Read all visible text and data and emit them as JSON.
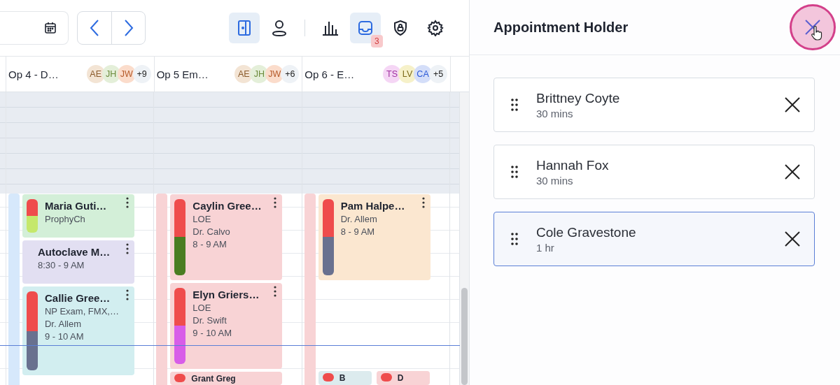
{
  "toolbar": {
    "date_field": {
      "kind": "date"
    },
    "tools": [
      {
        "kind": "door",
        "selected": true
      },
      {
        "kind": "person",
        "selected": false
      },
      {
        "kind": "chart",
        "selected": false
      },
      {
        "kind": "inbox",
        "selected": true,
        "badge": "3"
      },
      {
        "kind": "shield",
        "selected": false
      },
      {
        "kind": "gear",
        "selected": false
      }
    ]
  },
  "columns": [
    {
      "title": "Op 4 - D…",
      "color": "#d6e8fb",
      "avatars": [
        {
          "initials": "AE",
          "color": "#f3e4d4"
        },
        {
          "initials": "JH",
          "color": "#e4efd9"
        },
        {
          "initials": "JW",
          "color": "#fbdccb"
        },
        {
          "initials": "+9",
          "color": "#eef2f6"
        }
      ],
      "cards": [
        {
          "kind": "appointment",
          "name": "Maria Guti…",
          "lines": [
            "ProphyCh"
          ],
          "color": "#d3efd8",
          "bar": [
            {
              "color": "#ef4c4c"
            },
            {
              "color": "#c5e86b"
            }
          ]
        },
        {
          "kind": "block",
          "name": "Autoclave M…",
          "lines": [
            "8:30 - 9 AM"
          ],
          "color": "#e2dff2"
        },
        {
          "kind": "appointment",
          "name": "Callie Gree…",
          "lines": [
            "NP Exam, FMX,…",
            "Dr. Allem",
            "9 - 10 AM"
          ],
          "color": "#d2eef0",
          "bar": [
            {
              "color": "#ef4c4c"
            },
            {
              "color": "#69718f"
            }
          ]
        }
      ]
    },
    {
      "title": "Op 5 Em…",
      "color": "#f8d3d5",
      "avatars": [
        {
          "initials": "AE",
          "color": "#f3e4d4"
        },
        {
          "initials": "JH",
          "color": "#e4efd9"
        },
        {
          "initials": "JW",
          "color": "#fbdccb"
        },
        {
          "initials": "+6",
          "color": "#eef2f6"
        }
      ],
      "cards": [
        {
          "kind": "appointment",
          "name": "Caylin Gree…",
          "lines": [
            "LOE",
            "Dr. Calvo",
            "8 - 9 AM"
          ],
          "color": "#f8d3d5",
          "bar": [
            {
              "color": "#ef4c4c"
            },
            {
              "color": "#4a7d22"
            }
          ]
        },
        {
          "kind": "appointment",
          "name": "Elyn Griers…",
          "lines": [
            "LOE",
            "Dr. Swift",
            "9 - 10 AM"
          ],
          "color": "#f8d3d5",
          "bar": [
            {
              "color": "#ef4c4c"
            },
            {
              "color": "#d85de8"
            }
          ]
        },
        {
          "kind": "stub",
          "name": "Grant Greg",
          "color": "#f8d3d5",
          "bar": [
            {
              "color": "#ef4c4c"
            }
          ]
        }
      ]
    },
    {
      "title": "Op 6 - E…",
      "color": "#f8d3d5",
      "avatars": [
        {
          "initials": "TS",
          "color": "#f5d6f5"
        },
        {
          "initials": "LV",
          "color": "#f6f1c9"
        },
        {
          "initials": "CA",
          "color": "#d4def9"
        },
        {
          "initials": "+5",
          "color": "#eef2f6"
        }
      ],
      "cards": [
        {
          "kind": "appointment",
          "name": "Pam Halpe…",
          "lines": [
            "Dr. Allem",
            "8 - 9 AM"
          ],
          "color": "#fbe7d0",
          "bar": [
            {
              "color": "#ef4c4c"
            },
            {
              "color": "#69718f"
            }
          ]
        },
        {
          "kind": "stub",
          "name": "B",
          "color": "#dcebee",
          "bar": [
            {
              "color": "#ef4c4c"
            }
          ]
        },
        {
          "kind": "stub",
          "name": "D",
          "color": "#f8d3d5",
          "bar": [
            {
              "color": "#ef4c4c"
            }
          ]
        }
      ]
    }
  ],
  "panel": {
    "title": "Appointment Holder",
    "items": [
      {
        "name": "Brittney Coyte",
        "duration": "30 mins",
        "selected": false
      },
      {
        "name": "Hannah Fox",
        "duration": "30 mins",
        "selected": false
      },
      {
        "name": "Cole Gravestone",
        "duration": "1 hr",
        "selected": true
      }
    ]
  }
}
